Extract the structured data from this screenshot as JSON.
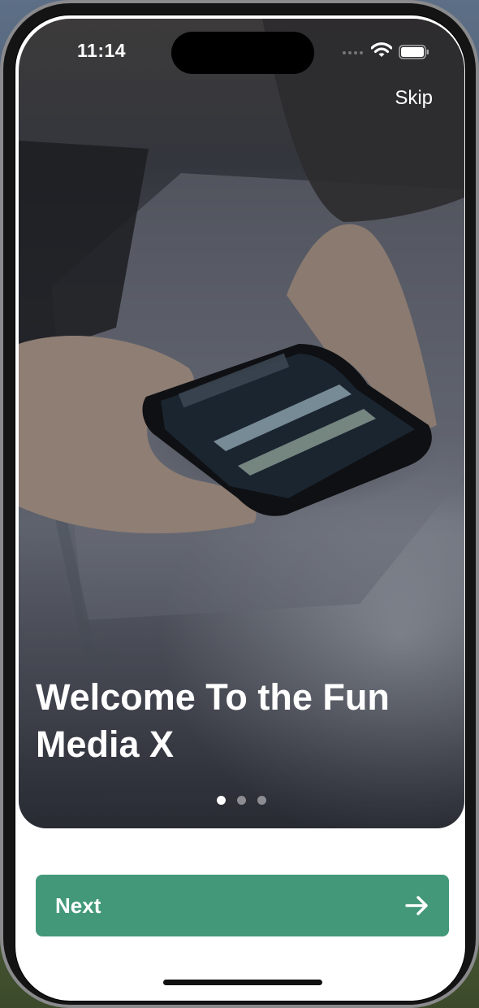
{
  "status_bar": {
    "time": "11:14",
    "icons": [
      "cellular-signal-icon",
      "wifi-icon",
      "battery-icon"
    ]
  },
  "header": {
    "skip_label": "Skip"
  },
  "onboarding": {
    "title_line1": "Welcome To the Fun",
    "title_line2": "Media X",
    "page_count": 3,
    "active_page": 1
  },
  "footer": {
    "next_label": "Next",
    "next_icon": "arrow-right-icon"
  },
  "colors": {
    "primary_button": "#43987a",
    "text_on_image": "#ffffff"
  }
}
